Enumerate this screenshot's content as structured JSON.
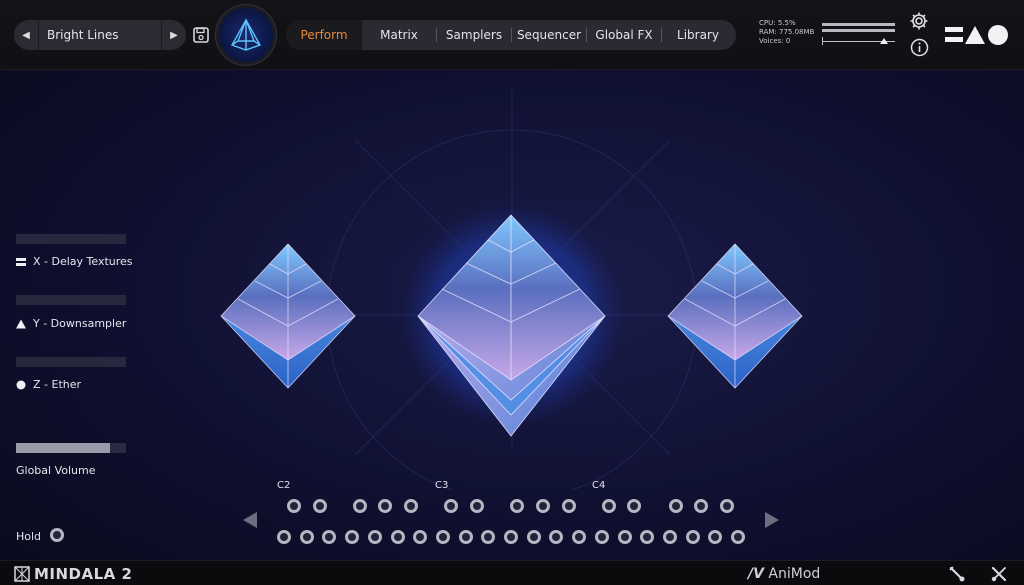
{
  "header": {
    "preset_name": "Bright Lines",
    "tabs": [
      "Perform",
      "Matrix",
      "Samplers",
      "Sequencer",
      "Global FX",
      "Library"
    ],
    "active_tab": "Perform",
    "active_color": "#e58a3c",
    "stats": {
      "cpu": "CPU: 5.5%",
      "ram": "RAM: 775.08MB",
      "voices": "Voices: 0"
    }
  },
  "left_panel": {
    "x_label": "X - Delay Textures",
    "y_label": "Y - Downsampler",
    "z_label": "Z - Ether",
    "global_volume_label": "Global Volume",
    "global_volume_level": 0.85,
    "hold_label": "Hold"
  },
  "keyboard": {
    "octave_labels": [
      "C2",
      "C3",
      "C4"
    ]
  },
  "footer": {
    "brand": "MINDALA 2",
    "animod": "AniMod"
  },
  "icons": [
    "prev-preset-icon",
    "next-preset-icon",
    "save-icon",
    "pyramid-logo-icon",
    "gear-icon",
    "info-icon",
    "xyz-logo-icon",
    "x-bars-icon",
    "y-triangle-icon",
    "z-circle-icon",
    "keyboard-left-icon",
    "keyboard-right-icon",
    "wrench-tool-icon",
    "cross-tool-icon",
    "brand-logo-icon"
  ]
}
